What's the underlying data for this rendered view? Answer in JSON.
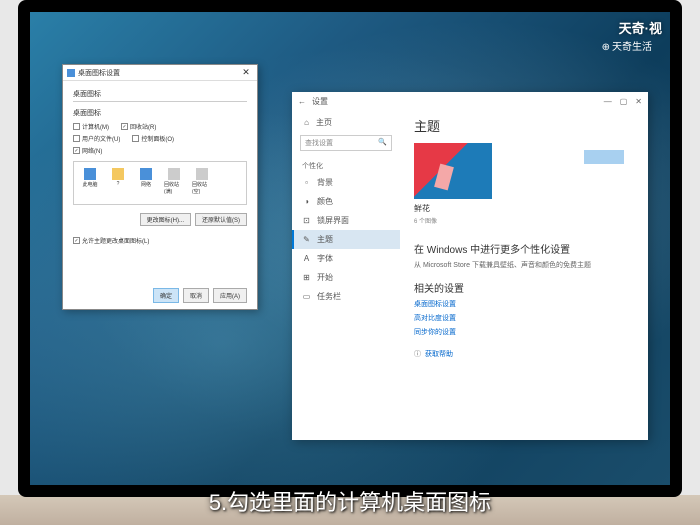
{
  "watermark": {
    "top": "天奇·视",
    "sub": "天奇生活"
  },
  "caption": "5.勾选里面的计算机桌面图标",
  "dialog": {
    "title": "桌面图标设置",
    "tab": "桌面图标",
    "section_label": "桌面图标",
    "checks": [
      {
        "label": "计算机(M)",
        "checked": false
      },
      {
        "label": "回收站(R)",
        "checked": true
      },
      {
        "label": "用户的文件(U)",
        "checked": false
      },
      {
        "label": "控制面板(O)",
        "checked": false
      },
      {
        "label": "网络(N)",
        "checked": false
      }
    ],
    "icons": [
      {
        "label": "此电脑"
      },
      {
        "label": "?"
      },
      {
        "label": "网络"
      },
      {
        "label": "回收站(满)"
      },
      {
        "label": "回收站(空)"
      }
    ],
    "btn_change": "更改图标(H)...",
    "btn_restore": "还原默认值(S)",
    "allow_themes": "允许主题更改桌面图标(L)",
    "ok": "确定",
    "cancel": "取消",
    "apply": "应用(A)"
  },
  "settings": {
    "window": "设置",
    "home": "主页",
    "search_ph": "查找设置",
    "category": "个性化",
    "items": [
      {
        "ico": "▫",
        "label": "背景"
      },
      {
        "ico": "◑",
        "label": "颜色"
      },
      {
        "ico": "⊡",
        "label": "锁屏界面"
      },
      {
        "ico": "✎",
        "label": "主题",
        "active": true
      },
      {
        "ico": "A",
        "label": "字体"
      },
      {
        "ico": "⊞",
        "label": "开始"
      },
      {
        "ico": "▭",
        "label": "任务栏"
      }
    ],
    "heading": "主题",
    "theme_name": "鲜花",
    "theme_sub": "6 个图像",
    "more_title": "在 Windows 中进行更多个性化设置",
    "more_sub": "从 Microsoft Store 下载兼具壁纸、声音和颜色的免费主题",
    "related_title": "相关的设置",
    "links": [
      "桌面图标设置",
      "高对比度设置",
      "同步你的设置"
    ],
    "help": "获取帮助"
  }
}
